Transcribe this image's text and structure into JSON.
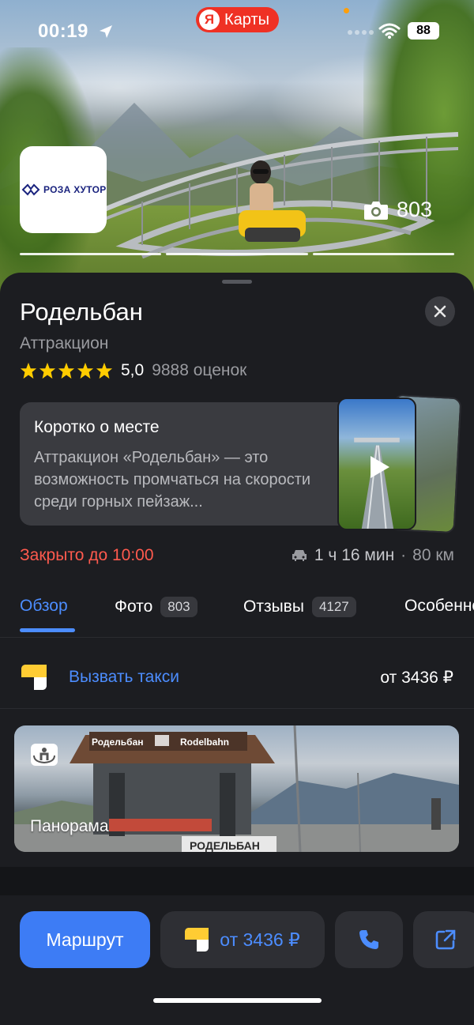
{
  "status_bar": {
    "time": "00:19",
    "app_name": "Карты",
    "app_badge": "Я",
    "battery": "88"
  },
  "hero": {
    "logo_text": "РОЗА ХУТОР",
    "photo_count": "803",
    "progress_segments": 3
  },
  "place": {
    "title": "Родельбан",
    "category": "Аттракцион",
    "rating_value": "5,0",
    "rating_count": "9888 оценок",
    "stars": 5
  },
  "about": {
    "title": "Коротко о месте",
    "text": "Аттракцион «Родельбан» — это возможность промчаться на скорости среди горных пейзаж..."
  },
  "status": {
    "hours": "Закрыто до 10:00",
    "travel_time": "1 ч 16 мин",
    "distance_sep": "·",
    "distance": "80 км"
  },
  "tabs": [
    {
      "label": "Обзор",
      "badge": "",
      "active": true
    },
    {
      "label": "Фото",
      "badge": "803",
      "active": false
    },
    {
      "label": "Отзывы",
      "badge": "4127",
      "active": false
    },
    {
      "label": "Особенности",
      "badge": "",
      "active": false
    }
  ],
  "taxi": {
    "label": "Вызвать такси",
    "price": "от 3436 ₽"
  },
  "panorama": {
    "label": "Панорама",
    "sign_left": "Родельбан",
    "sign_right": "Rodelbahn",
    "banner": "РОДЕЛЬБАН"
  },
  "actions": {
    "route_label": "Маршрут",
    "taxi_price": "от 3436 ₽"
  },
  "colors": {
    "accent": "#3d7cf5",
    "link": "#4c8dff",
    "closed": "#ff5a4e",
    "star": "#ffcc00",
    "sheet_bg": "#1c1d21",
    "card_bg": "#3a3b40"
  }
}
